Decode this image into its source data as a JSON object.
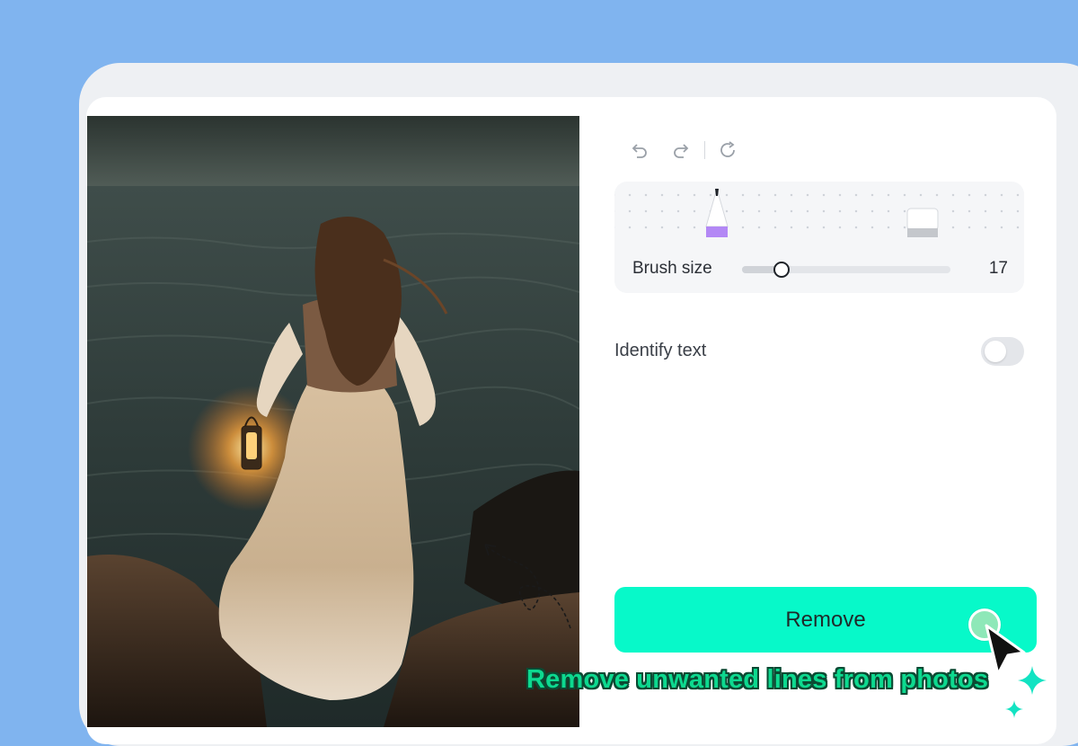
{
  "toolbar": {
    "icons": [
      "undo-icon",
      "redo-icon",
      "reset-icon"
    ]
  },
  "brush": {
    "label": "Brush size",
    "value": "17",
    "slider_fraction": 0.19,
    "tools": [
      "brush-icon",
      "eraser-icon"
    ],
    "active_tool": "brush",
    "accent_color": "#b388f5"
  },
  "identify": {
    "label": "Identify text",
    "enabled": false
  },
  "actions": {
    "remove_label": "Remove",
    "remove_color": "#07f9c9"
  },
  "caption": "Remove unwanted lines from photos"
}
